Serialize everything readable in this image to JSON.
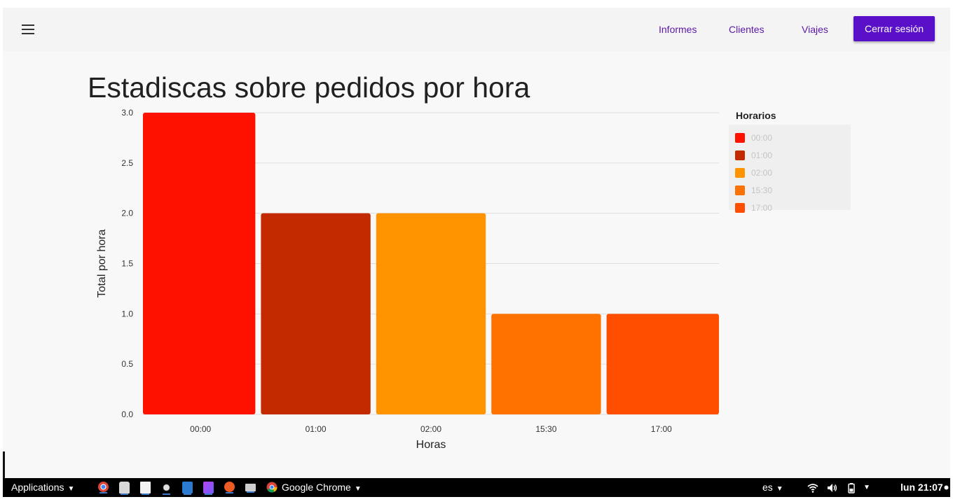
{
  "toolbar": {
    "nav": [
      "Informes",
      "Clientes",
      "Viajes"
    ],
    "logout_label": "Cerrar sesión",
    "accent_color": "#5a0fc8",
    "link_color": "#5b17a8"
  },
  "page": {
    "title": "Estadiscas sobre pedidos por hora"
  },
  "chart_data": {
    "type": "bar",
    "title": "",
    "categories": [
      "00:00",
      "01:00",
      "02:00",
      "15:30",
      "17:00"
    ],
    "values": [
      3,
      2,
      2,
      1,
      1
    ],
    "colors": [
      "#ff1100",
      "#c42a00",
      "#ff9300",
      "#ff7200",
      "#ff4e00"
    ],
    "xlabel": "Horas",
    "ylabel": "Total por hora",
    "ylim": [
      0,
      3
    ],
    "yticks": [
      "0.0",
      "0.5",
      "1.0",
      "1.5",
      "2.0",
      "2.5",
      "3.0"
    ],
    "grid": true,
    "legend_title": "Horarios",
    "legend_position": "right"
  },
  "taskbar": {
    "applications_label": "Applications",
    "window_label": "Google Chrome",
    "language": "es",
    "clock": "lun 21:07",
    "launchers": [
      "chrome-icon",
      "home-folder-icon",
      "text-editor-icon",
      "bug-icon",
      "vscode-icon",
      "phpstorm-icon",
      "postman-icon",
      "terminal-icon"
    ]
  }
}
